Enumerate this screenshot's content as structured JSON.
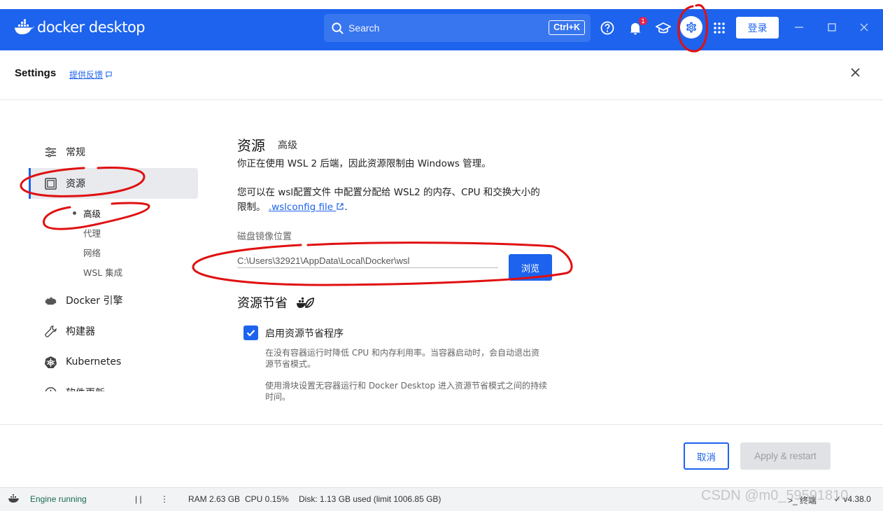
{
  "app": {
    "logo_text": "docker desktop"
  },
  "titlebar": {
    "search_placeholder": "Search",
    "search_shortcut": "Ctrl+K",
    "notification_count": "1",
    "login_label": "登录"
  },
  "settings": {
    "title": "Settings",
    "feedback_label": "提供反馈"
  },
  "sidebar": {
    "items": [
      {
        "label": "常规",
        "icon": "sliders-icon"
      },
      {
        "label": "资源",
        "icon": "resources-icon",
        "active": true
      },
      {
        "label": "Docker 引擎",
        "icon": "engine-icon"
      },
      {
        "label": "构建器",
        "icon": "wrench-icon"
      },
      {
        "label": "Kubernetes",
        "icon": "helm-icon"
      },
      {
        "label": "软件更新",
        "icon": "update-icon"
      }
    ],
    "sub_items": [
      "高级",
      "代理",
      "网络",
      "WSL 集成"
    ]
  },
  "main": {
    "heading": "资源",
    "subheading": "高级",
    "wsl_notice": "你正在使用 WSL 2 后端，因此资源限制由 Windows 管理。",
    "config_line1": "您可以在 wsl配置文件 中配置分配给 WSL2 的内存、CPU 和交换大小的",
    "config_line2_prefix": "限制。",
    "config_link": ".wslconfig file",
    "config_line2_suffix": ".",
    "disk_label": "磁盘镜像位置",
    "disk_path": "C:\\Users\\32921\\AppData\\Local\\Docker\\wsl",
    "browse_label": "浏览",
    "saver_heading": "资源节省",
    "saver_checkbox_label": "启用资源节省程序",
    "saver_checked": true,
    "saver_desc1_line1": "在没有容器运行时降低 CPU 和内存利用率。当容器启动时，会自动退出资",
    "saver_desc1_line2": "源节省模式。",
    "saver_desc2_line1": "使用滑块设置无容器运行和 Docker Desktop 进入资源节省模式之间的持续",
    "saver_desc2_line2": "时间。"
  },
  "footer": {
    "cancel_label": "取消",
    "apply_label": "Apply & restart"
  },
  "statusbar": {
    "engine_status": "Engine running",
    "pause_glyph": "| |",
    "more_glyph": "⋮",
    "ram": "RAM 2.63 GB",
    "cpu": "CPU 0.15%",
    "disk": "Disk: 1.13 GB used (limit 1006.85 GB)",
    "terminal_label": ">_ 终端",
    "version": "✓ v4.38.0"
  },
  "watermark": "CSDN @m0_59591810",
  "colors": {
    "brand_blue": "#1d63ed",
    "annotation_red": "#e01010"
  }
}
